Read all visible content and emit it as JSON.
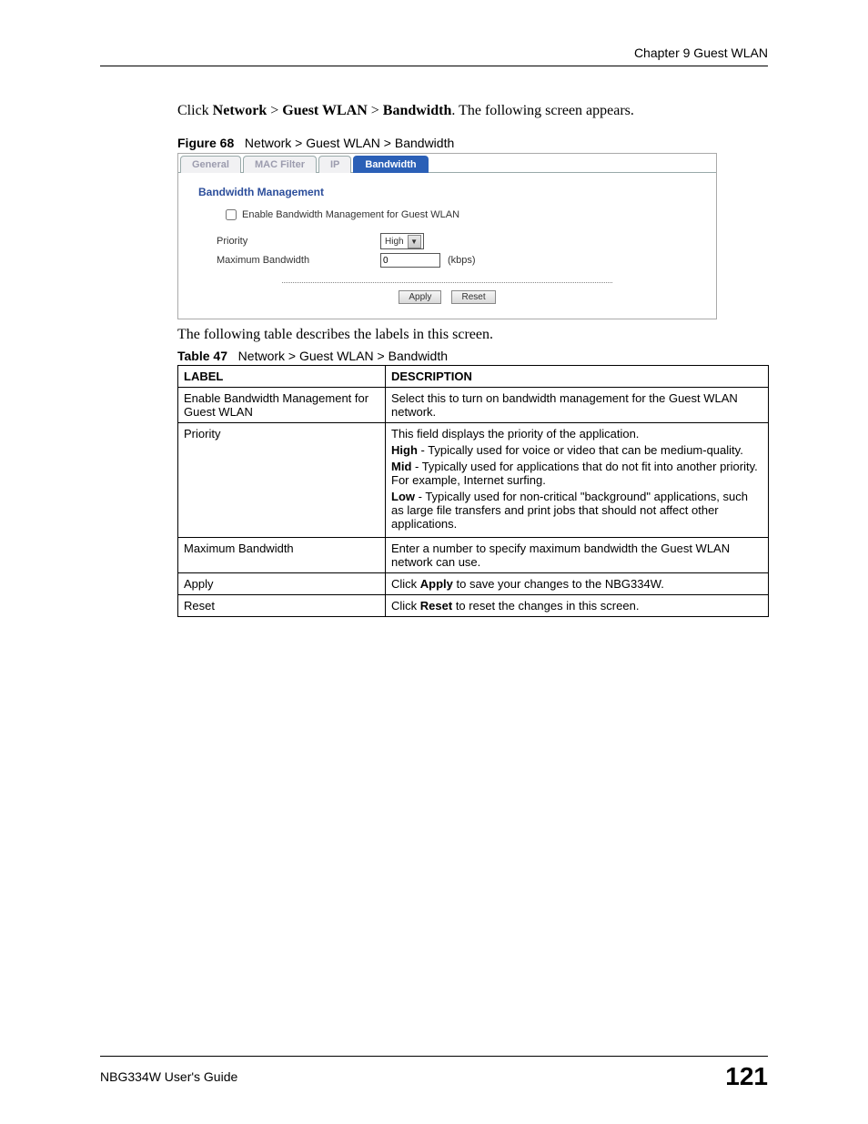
{
  "header": {
    "chapter": "Chapter 9 Guest WLAN"
  },
  "intro": {
    "prefix": "Click ",
    "b1": "Network",
    "sep1": " > ",
    "b2": "Guest WLAN",
    "sep2": " > ",
    "b3": "Bandwidth",
    "suffix": ". The following screen appears."
  },
  "figure": {
    "label": "Figure 68",
    "caption": "Network > Guest WLAN > Bandwidth"
  },
  "screenshot": {
    "tabs": {
      "general": "General",
      "mac_filter": "MAC Filter",
      "ip": "IP",
      "bandwidth": "Bandwidth"
    },
    "section_title": "Bandwidth Management",
    "enable_label": "Enable Bandwidth Management for Guest WLAN",
    "priority_label": "Priority",
    "priority_value": "High",
    "max_bw_label": "Maximum Bandwidth",
    "max_bw_value": "0",
    "unit": "(kbps)",
    "apply": "Apply",
    "reset": "Reset"
  },
  "after_text": "The following table describes the labels in this screen.",
  "table": {
    "label": "Table 47",
    "caption": "Network > Guest WLAN > Bandwidth",
    "head_label": "LABEL",
    "head_desc": "DESCRIPTION",
    "rows": {
      "r0": {
        "label": "Enable Bandwidth Management for Guest WLAN",
        "desc": "Select this to turn on bandwidth management for the Guest WLAN network."
      },
      "r1": {
        "label": "Priority",
        "p0": "This field displays the priority of the application.",
        "p1b": "High",
        "p1": " - Typically used for voice or video that can be medium-quality.",
        "p2b": "Mid",
        "p2": " - Typically used for applications that do not fit into another priority. For example, Internet surfing.",
        "p3b": "Low",
        "p3": " - Typically used for non-critical \"background\" applications, such as large file transfers and print jobs that should not affect other applications."
      },
      "r2": {
        "label": "Maximum Bandwidth",
        "desc": "Enter a number to specify maximum bandwidth the Guest WLAN network can use."
      },
      "r3": {
        "label": "Apply",
        "pre": "Click ",
        "b": "Apply",
        "post": " to save your changes to the NBG334W."
      },
      "r4": {
        "label": "Reset",
        "pre": "Click ",
        "b": "Reset",
        "post": " to reset the changes in this screen."
      }
    }
  },
  "footer": {
    "guide": "NBG334W User's Guide",
    "page": "121"
  }
}
